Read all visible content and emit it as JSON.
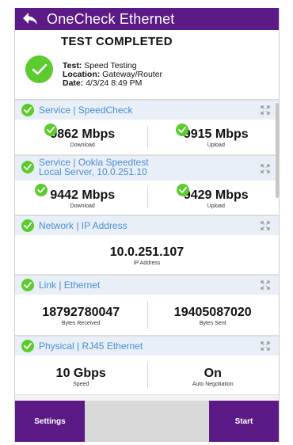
{
  "header": {
    "title": "OneCheck Ethernet"
  },
  "summary": {
    "title": "TEST COMPLETED",
    "test_label": "Test:",
    "test_value": "Speed Testing",
    "location_label": "Location:",
    "location_value": "Gateway/Router",
    "date_label": "Date:",
    "date_value": "4/3/24 8:49 PM"
  },
  "sections": {
    "speedcheck": {
      "title": "Service | SpeedCheck",
      "left_value": "9862 Mbps",
      "left_label": "Download",
      "right_value": "9915 Mbps",
      "right_label": "Upload"
    },
    "ookla": {
      "title_line1": "Service | Ookla Speedtest",
      "title_line2": "Local Server, 10.0.251.10",
      "left_value": "9442 Mbps",
      "left_label": "Download",
      "right_value": "9429 Mbps",
      "right_label": "Upload"
    },
    "network": {
      "title": "Network | IP Address",
      "value": "10.0.251.107",
      "label": "IP Address"
    },
    "link": {
      "title": "Link | Ethernet",
      "left_value": "18792780047",
      "left_label": "Bytes Received",
      "right_value": "19405087020",
      "right_label": "Bytes Sent"
    },
    "physical": {
      "title": "Physical | RJ45 Ethernet",
      "left_value": "10 Gbps",
      "left_label": "Speed",
      "right_value": "On",
      "right_label": "Auto Negotiation"
    }
  },
  "footer": {
    "settings_label": "Settings",
    "start_label": "Start"
  },
  "colors": {
    "brand": "#5b1a86",
    "success": "#5ccb2f",
    "section_title": "#4a8ed4",
    "section_bg": "#e8eff6"
  },
  "icons": [
    "back-arrow-icon",
    "check-icon",
    "expand-icon"
  ]
}
